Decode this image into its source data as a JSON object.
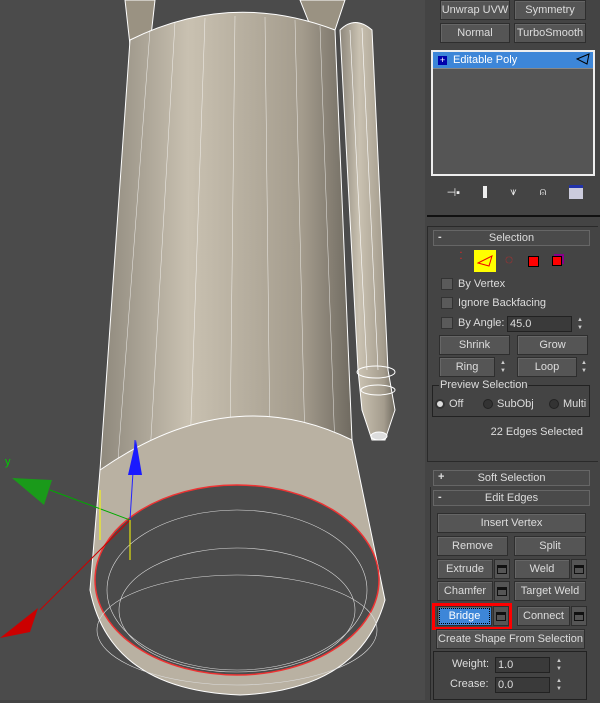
{
  "modifier_buttons": [
    "Unwrap UVW",
    "Symmetry",
    "Normal",
    "TurboSmooth"
  ],
  "stack": {
    "items": [
      {
        "label": "Editable Poly",
        "selected": true
      }
    ]
  },
  "stack_tools": [
    "pin-stack-icon",
    "show-end-result-icon",
    "make-unique-icon",
    "remove-modifier-icon",
    "configure-modifier-sets-icon"
  ],
  "selection": {
    "title": "Selection",
    "subobject_modes": [
      "vertex",
      "edge",
      "border",
      "polygon",
      "element"
    ],
    "active_mode": "edge",
    "by_vertex": "By Vertex",
    "ignore_backfacing": "Ignore Backfacing",
    "by_angle": "By Angle:",
    "angle_value": "45.0",
    "shrink": "Shrink",
    "grow": "Grow",
    "ring": "Ring",
    "loop": "Loop",
    "preview_title": "Preview Selection",
    "preview_options": [
      "Off",
      "SubObj",
      "Multi"
    ],
    "preview_selected": "Off",
    "status": "22 Edges Selected"
  },
  "soft_selection": {
    "title": "Soft Selection"
  },
  "edit_edges": {
    "title": "Edit Edges",
    "insert_vertex": "Insert Vertex",
    "remove": "Remove",
    "split": "Split",
    "extrude": "Extrude",
    "weld": "Weld",
    "chamfer": "Chamfer",
    "target_weld": "Target Weld",
    "bridge": "Bridge",
    "connect": "Connect",
    "create_shape": "Create Shape From Selection",
    "weight_label": "Weight:",
    "weight": "1.0",
    "crease_label": "Crease:",
    "crease": "0.0"
  },
  "gizmo": {
    "y_label": "y"
  },
  "colors": {
    "highlight": "#3d86d8",
    "annotation": "#ff0000",
    "active_mode_bg": "#ffff00"
  }
}
